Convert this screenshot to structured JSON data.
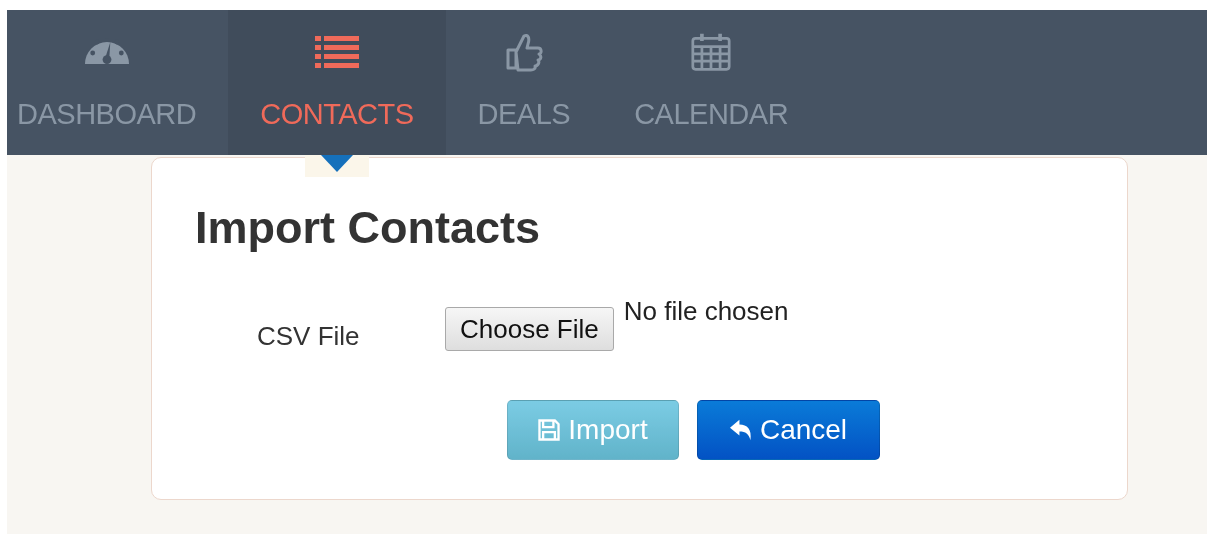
{
  "nav": {
    "tabs": [
      {
        "label": "DASHBOARD",
        "kind": "gauge",
        "selected": false
      },
      {
        "label": "CONTACTS",
        "kind": "list",
        "selected": true
      },
      {
        "label": "DEALS",
        "kind": "thumb",
        "selected": false
      },
      {
        "label": "CALENDAR",
        "kind": "calendar",
        "selected": false
      }
    ]
  },
  "form": {
    "title": "Import Contacts",
    "field_label": "CSV File",
    "file_button": "Choose File",
    "file_status": "No file chosen",
    "buttons": [
      {
        "label": "Import",
        "kind": "save",
        "disabled": true
      },
      {
        "label": "Cancel",
        "kind": "back",
        "disabled": false
      }
    ]
  }
}
